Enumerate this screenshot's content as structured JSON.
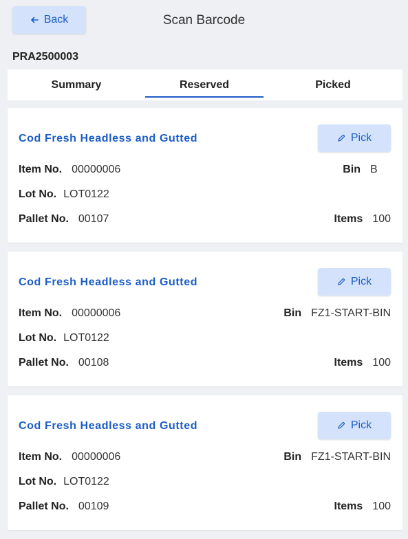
{
  "header": {
    "back_label": "Back",
    "title": "Scan Barcode"
  },
  "order_id": "PRA2500003",
  "tabs": [
    {
      "label": "Summary",
      "active": false
    },
    {
      "label": "Reserved",
      "active": true
    },
    {
      "label": "Picked",
      "active": false
    }
  ],
  "labels": {
    "item_no": "Item No.",
    "lot_no": "Lot No.",
    "pallet_no": "Pallet No.",
    "bin": "Bin",
    "items": "Items",
    "pick": "Pick"
  },
  "cards": [
    {
      "title": "Cod Fresh Headless and Gutted",
      "item_no": "00000006",
      "lot_no": "LOT0122",
      "pallet_no": "00107",
      "bin": "B",
      "items": "100"
    },
    {
      "title": "Cod Fresh Headless and Gutted",
      "item_no": "00000006",
      "lot_no": "LOT0122",
      "pallet_no": "00108",
      "bin": "FZ1-START-BIN",
      "items": "100"
    },
    {
      "title": "Cod Fresh Headless and Gutted",
      "item_no": "00000006",
      "lot_no": "LOT0122",
      "pallet_no": "00109",
      "bin": "FZ1-START-BIN",
      "items": "100"
    }
  ],
  "colors": {
    "accent": "#1a5cc8",
    "button_bg": "#d4e3fb",
    "page_bg": "#eef0f3"
  },
  "icons": {
    "back": "arrow-left-icon",
    "pick": "pencil-icon"
  }
}
